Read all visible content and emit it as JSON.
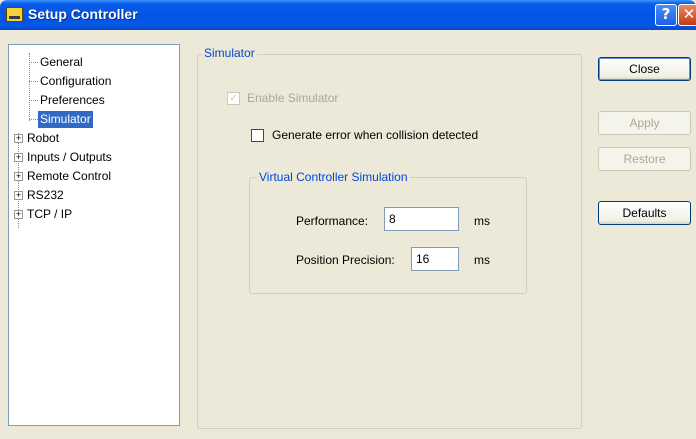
{
  "window": {
    "title": "Setup Controller",
    "help_glyph": "?",
    "close_glyph": "✕",
    "icon": "app-icon"
  },
  "tree": {
    "items": [
      {
        "label": "General"
      },
      {
        "label": "Configuration"
      },
      {
        "label": "Preferences"
      },
      {
        "label": "Simulator",
        "selected": true
      },
      {
        "label": "Robot",
        "expander": "+"
      },
      {
        "label": "Inputs / Outputs",
        "expander": "+"
      },
      {
        "label": "Remote Control",
        "expander": "+"
      },
      {
        "label": "RS232",
        "expander": "+"
      },
      {
        "label": "TCP / IP",
        "expander": "+"
      }
    ]
  },
  "simulator": {
    "group_title": "Simulator",
    "enable_simulator": {
      "label": "Enable Simulator",
      "checked": true,
      "enabled": false,
      "check_glyph": "✓"
    },
    "collision_error": {
      "label": "Generate error when collision detected",
      "checked": false
    },
    "virtual": {
      "group_title": "Virtual Controller Simulation",
      "performance": {
        "label": "Performance:",
        "value": "8",
        "unit": "ms"
      },
      "precision": {
        "label": "Position Precision:",
        "value": "16",
        "unit": "ms"
      }
    }
  },
  "buttons": {
    "close": "Close",
    "apply": "Apply",
    "restore": "Restore",
    "defaults": "Defaults"
  }
}
